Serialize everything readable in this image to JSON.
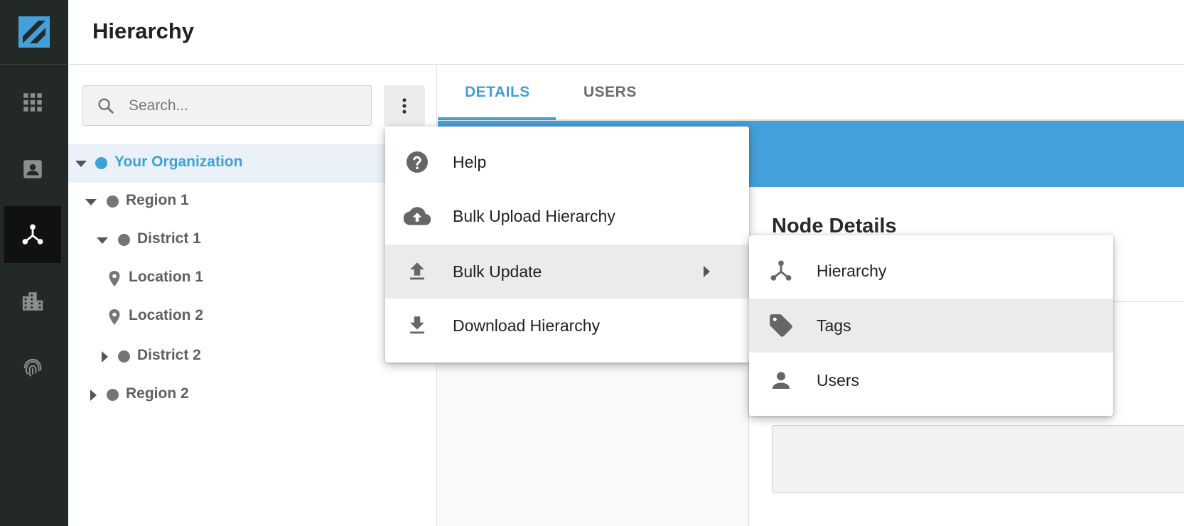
{
  "app": {
    "logo_icon": "brand-logo-icon",
    "brand_color": "#44a0db",
    "rail_color": "#232a25"
  },
  "rail": {
    "items": [
      {
        "icon": "apps-grid-icon"
      },
      {
        "icon": "contact-card-icon"
      },
      {
        "icon": "hierarchy-icon",
        "active": true
      },
      {
        "icon": "building-icon"
      },
      {
        "icon": "fingerprint-icon"
      }
    ]
  },
  "header": {
    "title": "Hierarchy"
  },
  "search": {
    "placeholder": "Search...",
    "value": ""
  },
  "tree": {
    "items": [
      {
        "label": "Your Organization",
        "selected": true
      },
      {
        "label": "Region 1"
      },
      {
        "label": "District 1"
      },
      {
        "label": "Location 1"
      },
      {
        "label": "Location 2"
      },
      {
        "label": "District 2"
      },
      {
        "label": "Region 2"
      }
    ]
  },
  "tabs": [
    {
      "label": "DETAILS",
      "active": true
    },
    {
      "label": "USERS",
      "active": false
    }
  ],
  "content": {
    "section_title": "Node Details"
  },
  "menu": {
    "items": [
      {
        "label": "Help",
        "icon": "help-circle-icon"
      },
      {
        "label": "Bulk Upload Hierarchy",
        "icon": "cloud-upload-icon"
      },
      {
        "label": "Bulk Update",
        "icon": "upload-icon",
        "has_submenu": true
      },
      {
        "label": "Download Hierarchy",
        "icon": "download-icon"
      }
    ]
  },
  "submenu": {
    "items": [
      {
        "label": "Hierarchy",
        "icon": "hierarchy-icon"
      },
      {
        "label": "Tags",
        "icon": "tag-icon"
      },
      {
        "label": "Users",
        "icon": "person-icon"
      }
    ]
  }
}
